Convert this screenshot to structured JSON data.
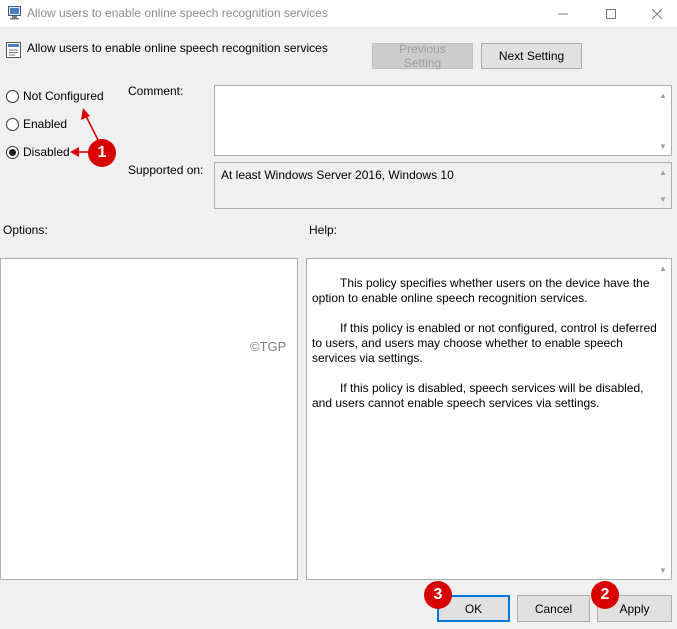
{
  "window": {
    "title": "Allow users to enable online speech recognition services"
  },
  "header": {
    "title": "Allow users to enable online speech recognition services",
    "previous_label": "Previous Setting",
    "next_label": "Next Setting"
  },
  "state": {
    "options": [
      {
        "label": "Not Configured",
        "selected": false
      },
      {
        "label": "Enabled",
        "selected": false
      },
      {
        "label": "Disabled",
        "selected": true
      }
    ]
  },
  "comment": {
    "label": "Comment:",
    "value": ""
  },
  "supported": {
    "label": "Supported on:",
    "value": "At least Windows Server 2016, Windows 10"
  },
  "options_panel": {
    "label": "Options:",
    "watermark": "©TGP"
  },
  "help": {
    "label": "Help:",
    "paragraphs": [
      "This policy specifies whether users on the device have the option to enable online speech recognition services.",
      "If this policy is enabled or not configured, control is deferred to users, and users may choose whether to enable speech services via settings.",
      "If this policy is disabled, speech services will be disabled, and users cannot enable speech services via settings."
    ]
  },
  "footer": {
    "ok_label": "OK",
    "cancel_label": "Cancel",
    "apply_label": "Apply"
  },
  "annotations": {
    "badge_1": "1",
    "badge_2": "2",
    "badge_3": "3",
    "color": "#d80000"
  }
}
